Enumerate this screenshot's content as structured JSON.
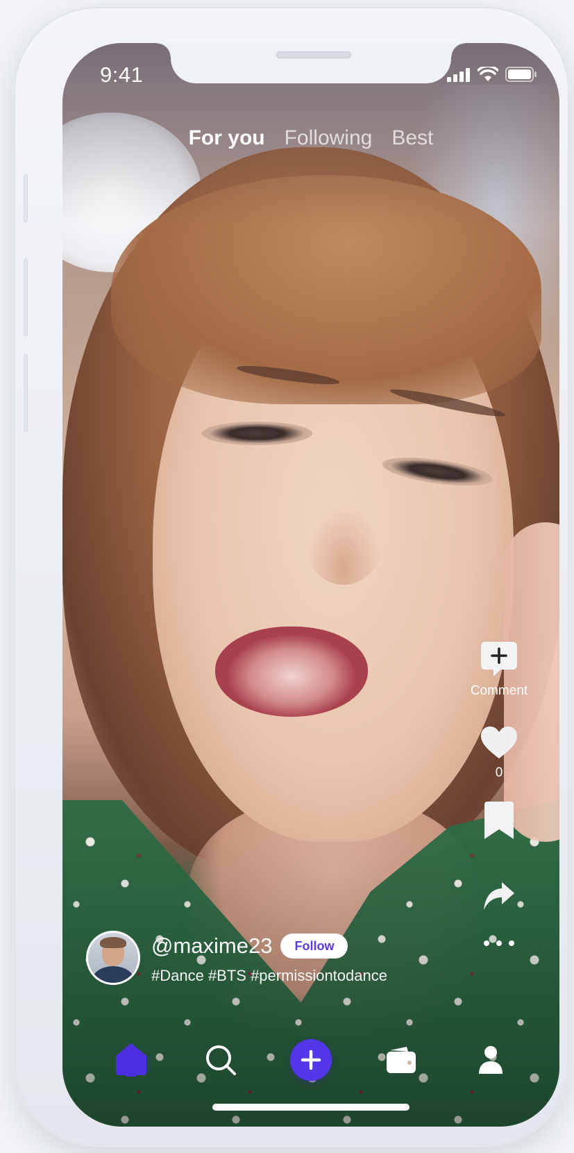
{
  "status_bar": {
    "time": "9:41",
    "icons": [
      "cellular-signal-icon",
      "wifi-icon",
      "battery-icon"
    ]
  },
  "tabs": [
    {
      "label": "For you",
      "active": true
    },
    {
      "label": "Following",
      "active": false
    },
    {
      "label": "Best",
      "active": false
    }
  ],
  "actions": {
    "comment": {
      "icon": "comment-plus-icon",
      "label": "Comment"
    },
    "like": {
      "icon": "heart-icon",
      "count": "0"
    },
    "save": {
      "icon": "bookmark-icon"
    },
    "share": {
      "icon": "share-arrow-icon"
    },
    "more": {
      "icon": "more-dots-icon"
    }
  },
  "post": {
    "username": "@maxime23",
    "follow_label": "Follow",
    "hashtags": "#Dance #BTS #permissiontodance"
  },
  "bottom_nav": {
    "items": [
      {
        "icon": "home-icon",
        "active": true
      },
      {
        "icon": "search-icon",
        "active": false
      },
      {
        "icon": "plus-icon",
        "active": false
      },
      {
        "icon": "wallet-icon",
        "active": false
      },
      {
        "icon": "profile-icon",
        "active": false
      }
    ]
  },
  "colors": {
    "accent": "#5236e8",
    "follow_text": "#5b3be6",
    "active_nav": "#4c2fe0"
  }
}
